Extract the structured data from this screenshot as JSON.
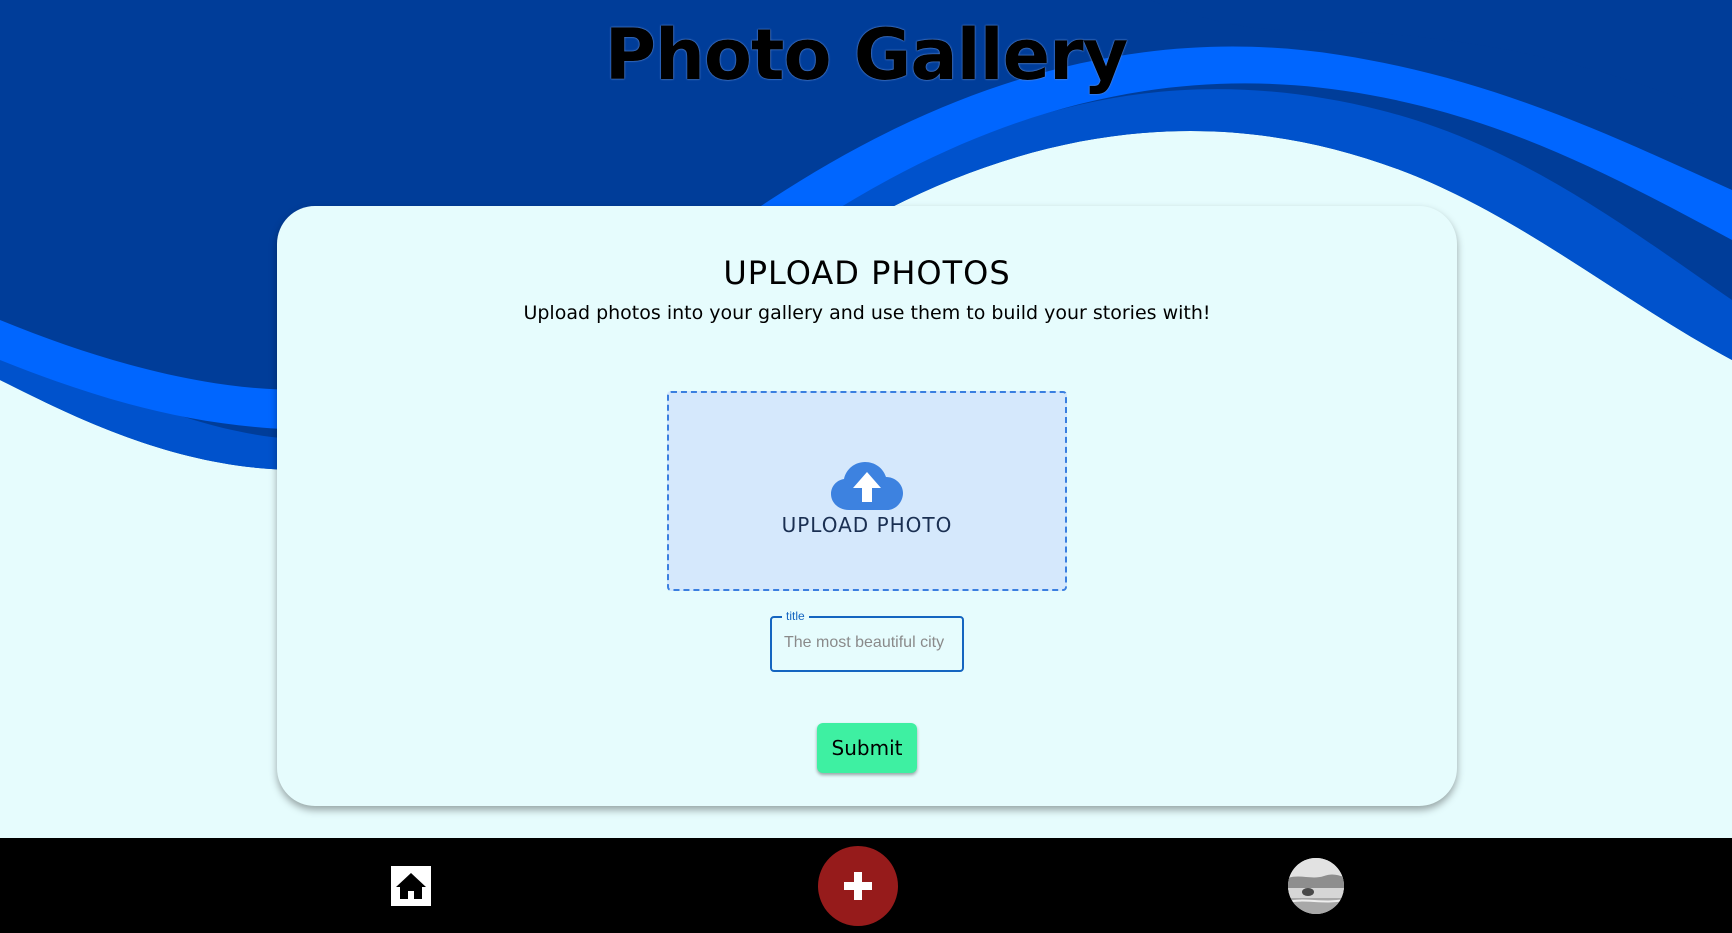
{
  "header": {
    "title": "Photo Gallery"
  },
  "upload_card": {
    "heading": "UPLOAD PHOTOS",
    "subtitle": "Upload photos into your gallery and use them to build your stories with!",
    "dropzone": {
      "icon": "cloud-upload-icon",
      "label": "UPLOAD PHOTO"
    },
    "title_field": {
      "label": "title",
      "placeholder": "The most beautiful city",
      "value": ""
    },
    "submit_label": "Submit"
  },
  "bottom_nav": {
    "items": [
      {
        "name": "home",
        "icon": "home-icon"
      },
      {
        "name": "add",
        "icon": "plus-icon"
      },
      {
        "name": "profile",
        "icon": "avatar"
      }
    ]
  },
  "colors": {
    "wave_dark": "#003d99",
    "wave_mid": "#0052cc",
    "wave_bright": "#0066ff",
    "background": "#e6fcfd",
    "dropzone_fill": "#d5e8fc",
    "dropzone_border": "#3a7fe0",
    "upload_icon": "#3d82e0",
    "input_border": "#1565c0",
    "submit_button": "#3ef0a2",
    "add_button": "#961b1b",
    "nav_bar": "#000000"
  }
}
